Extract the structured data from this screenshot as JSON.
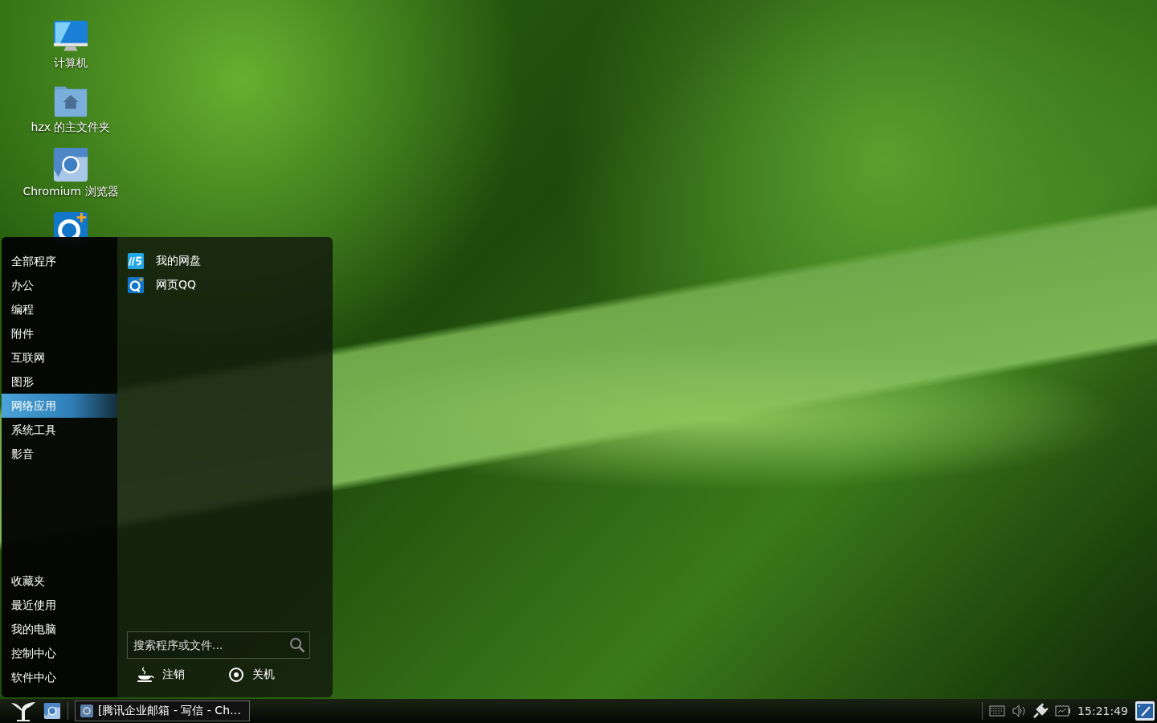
{
  "desktop_icons": [
    {
      "label": "计算机",
      "kind": "computer"
    },
    {
      "label": "hzx 的主文件夹",
      "kind": "home"
    },
    {
      "label": "Chromium 浏览器",
      "kind": "browser"
    },
    {
      "kind": "qq"
    }
  ],
  "menu": {
    "categories": [
      {
        "label": "全部程序",
        "selected": false
      },
      {
        "label": "办公",
        "selected": false
      },
      {
        "label": "编程",
        "selected": false
      },
      {
        "label": "附件",
        "selected": false
      },
      {
        "label": "互联网",
        "selected": false
      },
      {
        "label": "图形",
        "selected": false
      },
      {
        "label": "网络应用",
        "selected": true
      },
      {
        "label": "系统工具",
        "selected": false
      },
      {
        "label": "影音",
        "selected": false
      }
    ],
    "places": [
      "收藏夹",
      "最近使用",
      "我的电脑",
      "控制中心",
      "软件中心"
    ],
    "apps": [
      {
        "label": "我的网盘",
        "kind": "disk"
      },
      {
        "label": "网页QQ",
        "kind": "qq"
      }
    ],
    "search": {
      "placeholder": "搜索程序或文件..."
    },
    "actions": [
      {
        "label": "注销",
        "kind": "logout"
      },
      {
        "label": "关机",
        "kind": "shutdown"
      }
    ]
  },
  "taskbar": {
    "tasks": [
      {
        "title": "[腾讯企业邮箱 - 写信 - Ch…"
      }
    ],
    "clock": "15:21:49"
  }
}
